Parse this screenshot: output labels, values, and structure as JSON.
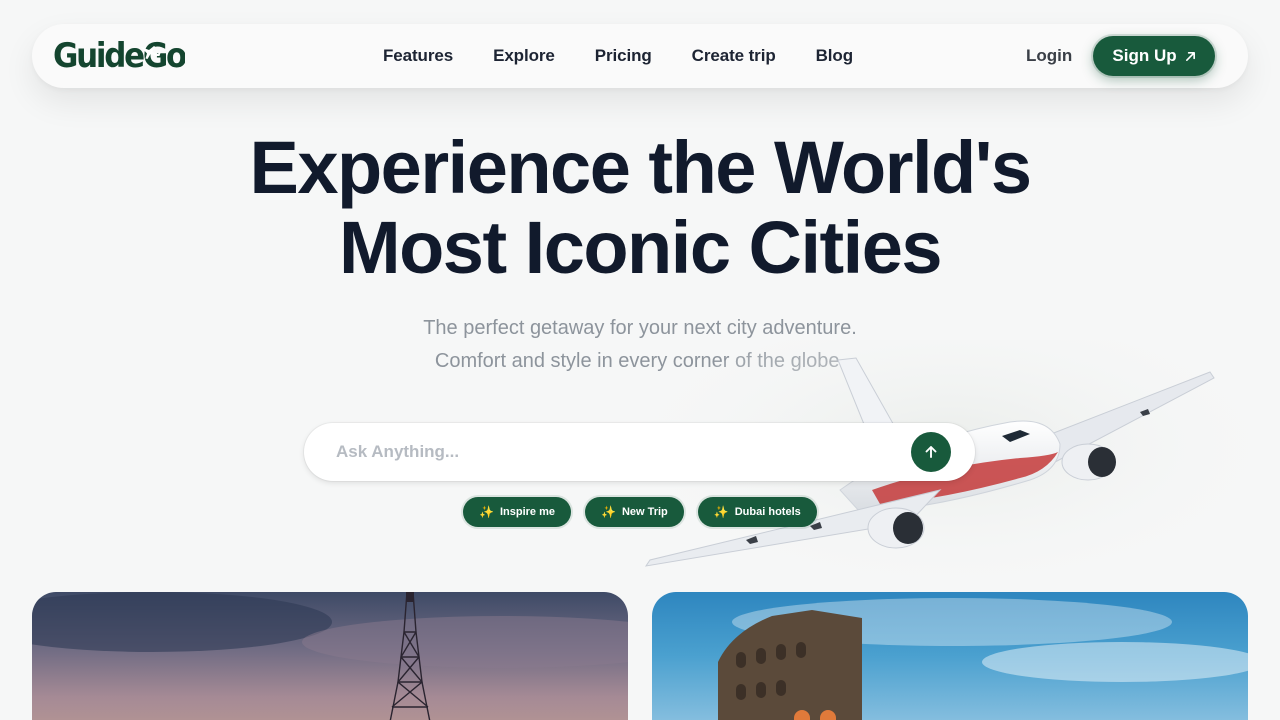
{
  "nav": {
    "logo_text": "GuideGo",
    "links": [
      {
        "label": "Features"
      },
      {
        "label": "Explore"
      },
      {
        "label": "Pricing"
      },
      {
        "label": "Create trip"
      },
      {
        "label": "Blog"
      }
    ],
    "login_label": "Login",
    "signup_label": "Sign Up"
  },
  "hero": {
    "headline_line1": "Experience the World's",
    "headline_line2": "Most Iconic Cities",
    "subtitle_line1": "The perfect getaway for your next city adventure.",
    "subtitle_line2": "Comfort and style in every corner of the globe."
  },
  "search": {
    "placeholder": "Ask Anything...",
    "value": ""
  },
  "chips": [
    {
      "label": "Inspire me",
      "icon": "sparkles-icon"
    },
    {
      "label": "New Trip",
      "icon": "sparkles-icon"
    },
    {
      "label": "Dubai hotels",
      "icon": "sparkles-icon"
    }
  ],
  "cards": [
    {
      "name": "paris-card",
      "image": "eiffel-tower-at-dusk"
    },
    {
      "name": "rome-card",
      "image": "colosseum-under-blue-sky"
    }
  ],
  "colors": {
    "brand_green": "#185a3c",
    "heading": "#111a2c",
    "subtitle": "#8d949c",
    "background": "#f6f7f7"
  }
}
